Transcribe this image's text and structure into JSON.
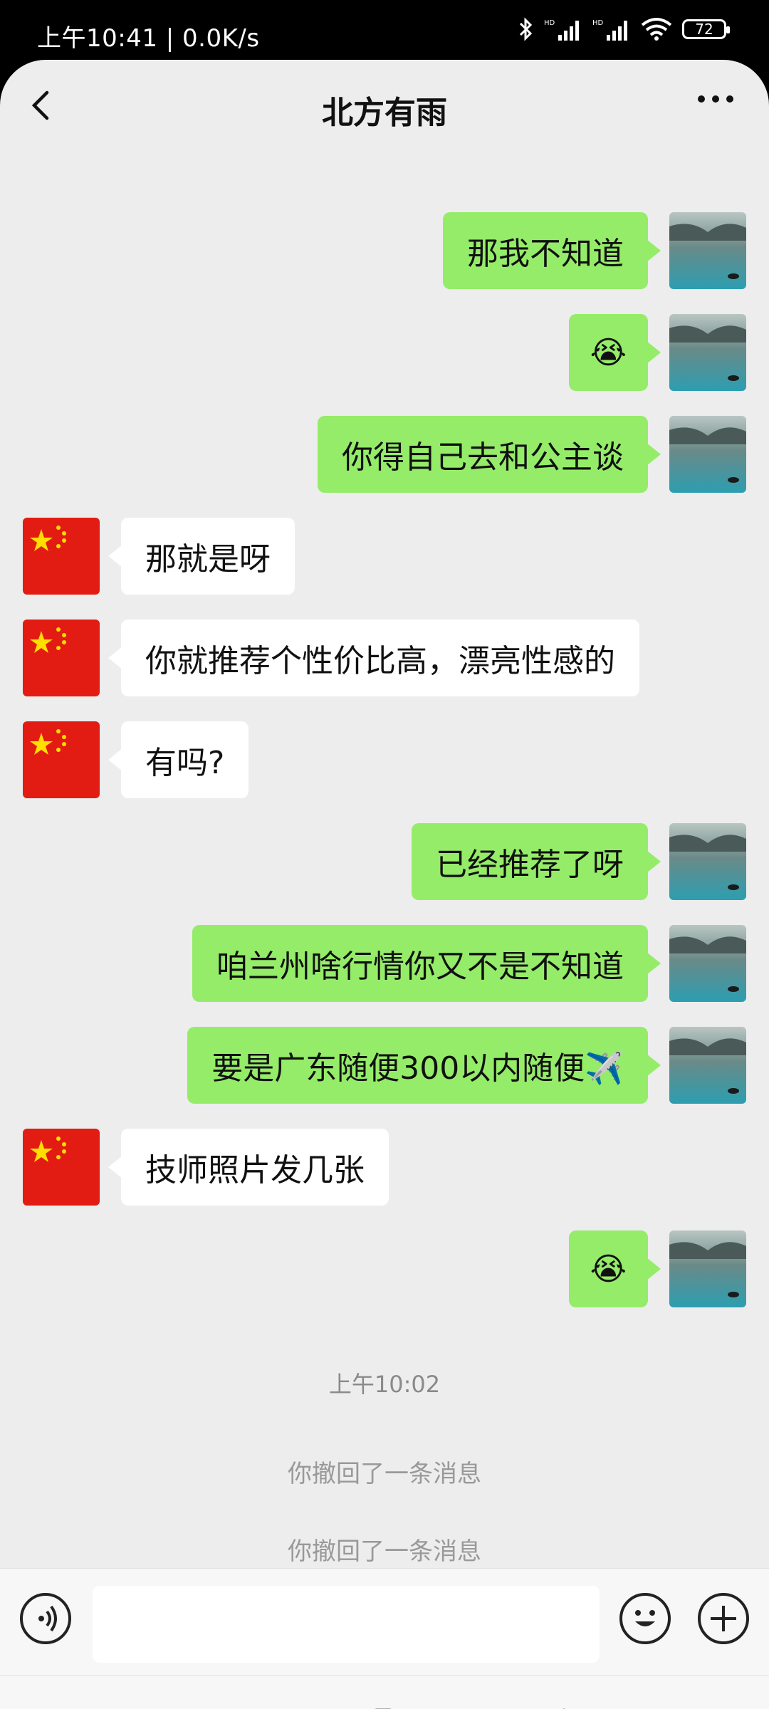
{
  "status_bar": {
    "time": "上午10:41 | 0.0K/s",
    "battery": "72"
  },
  "header": {
    "title": "北方有雨"
  },
  "messages": [
    {
      "side": "me",
      "text": "那我不知道"
    },
    {
      "side": "me",
      "text": "😭"
    },
    {
      "side": "me",
      "text": "你得自己去和公主谈"
    },
    {
      "side": "them",
      "text": "那就是呀"
    },
    {
      "side": "them",
      "text": "你就推荐个性价比高，漂亮性感的"
    },
    {
      "side": "them",
      "text": "有吗?"
    },
    {
      "side": "me",
      "text": "已经推荐了呀"
    },
    {
      "side": "me",
      "text": "咱兰州啥行情你又不是不知道"
    },
    {
      "side": "me",
      "text": "要是广东随便300以内随便✈️"
    },
    {
      "side": "them",
      "text": "技师照片发几张"
    },
    {
      "side": "me",
      "text": "😭"
    }
  ],
  "system": {
    "timestamp": "上午10:02",
    "recall_1": "你撤回了一条消息",
    "recall_2": "你撤回了一条消息"
  },
  "icons": {
    "back": "back-arrow-icon",
    "more": "more-dots-icon",
    "voice": "voice-icon",
    "emoji": "emoji-icon",
    "plus": "plus-icon",
    "menu": "nav-menu-icon",
    "home": "nav-home-icon",
    "nav_back": "nav-back-icon"
  },
  "colors": {
    "my_bubble": "#95ec69",
    "their_bubble": "#ffffff",
    "background": "#ededed"
  }
}
